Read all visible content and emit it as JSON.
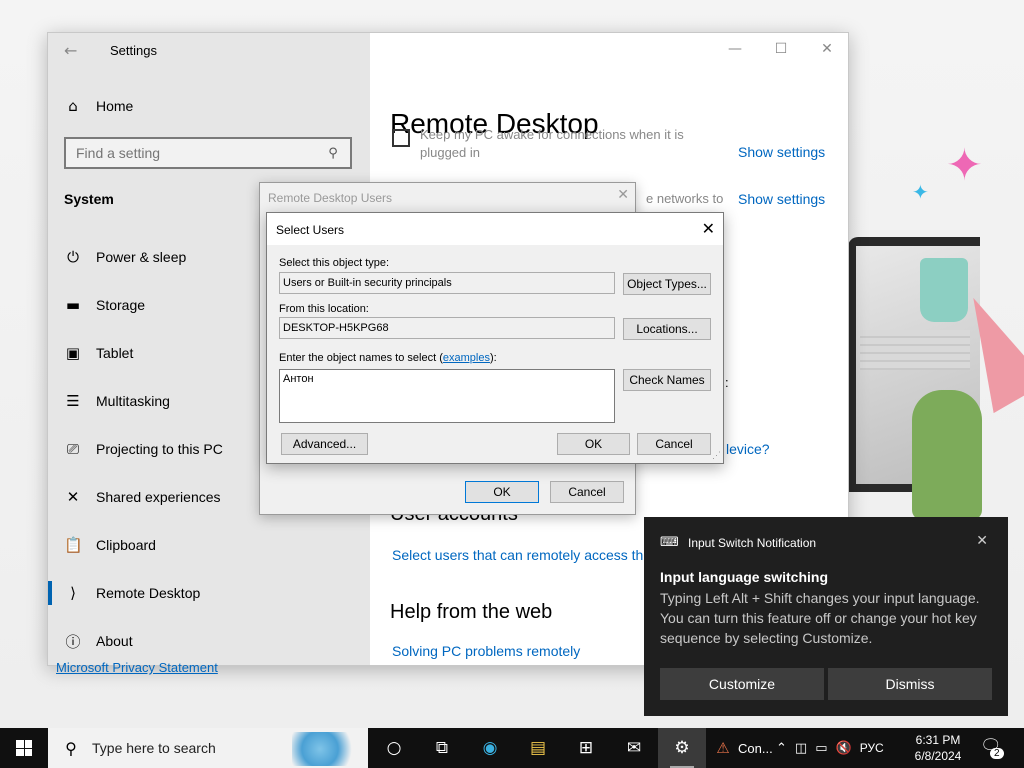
{
  "settings": {
    "title": "Settings",
    "home_label": "Home",
    "search_placeholder": "Find a setting",
    "section_label": "System",
    "nav_items": [
      {
        "label": "Power & sleep",
        "icon": "power-icon"
      },
      {
        "label": "Storage",
        "icon": "storage-icon"
      },
      {
        "label": "Tablet",
        "icon": "tablet-icon"
      },
      {
        "label": "Multitasking",
        "icon": "multitasking-icon"
      },
      {
        "label": "Projecting to this PC",
        "icon": "projecting-icon"
      },
      {
        "label": "Shared experiences",
        "icon": "shared-experiences-icon"
      },
      {
        "label": "Clipboard",
        "icon": "clipboard-icon"
      },
      {
        "label": "Remote Desktop",
        "icon": "remote-desktop-icon",
        "active": true
      },
      {
        "label": "About",
        "icon": "info-icon"
      }
    ],
    "content": {
      "page_title": "Remote Desktop",
      "keep_awake_text": "Keep my PC awake for connections when it is plugged in",
      "show_settings_1": "Show settings",
      "networks_fragment": "e networks to",
      "show_settings_2": "Show settings",
      "colon_fragment": ":",
      "device_fragment": "levice?",
      "user_accounts_heading": "User accounts",
      "select_users_link": "Select users that can remotely access this",
      "help_heading": "Help from the web",
      "solving_link": "Solving PC problems remotely",
      "privacy_fragment": "Microsoft Privacy Statement"
    }
  },
  "rdu_dialog": {
    "title": "Remote Desktop Users",
    "ok_label": "OK",
    "cancel_label": "Cancel"
  },
  "select_users": {
    "title": "Select Users",
    "object_type_label": "Select this object type:",
    "object_type_value": "Users or Built-in security principals",
    "object_types_button": "Object Types...",
    "location_label": "From this location:",
    "location_value": "DESKTOP-H5KPG68",
    "locations_button": "Locations...",
    "names_label_prefix": "Enter the object names to select (",
    "names_label_link": "examples",
    "names_label_suffix": "):",
    "names_value": "Антон",
    "check_names_button": "Check Names",
    "advanced_button": "Advanced...",
    "ok_button": "OK",
    "cancel_button": "Cancel"
  },
  "toast": {
    "app_name": "Input Switch Notification",
    "title": "Input language switching",
    "body": "Typing Left Alt + Shift changes your input language. You can turn this feature off or change your hot key sequence by selecting Customize.",
    "customize_label": "Customize",
    "dismiss_label": "Dismiss"
  },
  "taskbar": {
    "search_placeholder": "Type here to search",
    "running_app_label": "Con...",
    "language": "РУС",
    "time": "6:31 PM",
    "date": "6/8/2024",
    "notification_count": "2"
  },
  "colors": {
    "accent": "#0067c0",
    "nav_bg": "#e6e6e6",
    "toast_bg": "#1f1f1f",
    "taskbar_bg": "#101010"
  }
}
